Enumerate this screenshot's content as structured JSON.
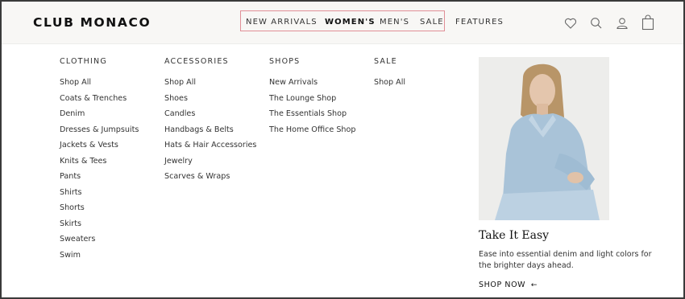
{
  "brand": "CLUB MONACO",
  "nav": {
    "new_arrivals": "NEW ARRIVALS",
    "womens": "WOMEN'S",
    "mens": "MEN'S",
    "sale": "SALE",
    "features": "FEATURES"
  },
  "icons": [
    "heart-icon",
    "search-icon",
    "account-icon",
    "bag-icon"
  ],
  "menu": {
    "clothing": {
      "heading": "CLOTHING",
      "links": [
        "Shop All",
        "Coats & Trenches",
        "Denim",
        "Dresses & Jumpsuits",
        "Jackets & Vests",
        "Knits & Tees",
        "Pants",
        "Shirts",
        "Shorts",
        "Skirts",
        "Sweaters",
        "Swim"
      ]
    },
    "accessories": {
      "heading": "ACCESSORIES",
      "links": [
        "Shop All",
        "Shoes",
        "Candles",
        "Handbags & Belts",
        "Hats & Hair Accessories",
        "Jewelry",
        "Scarves & Wraps"
      ]
    },
    "shops": {
      "heading": "SHOPS",
      "links": [
        "New Arrivals",
        "The Lounge Shop",
        "The Essentials Shop",
        "The Home Office Shop"
      ]
    },
    "sale": {
      "heading": "SALE",
      "links": [
        "Shop All"
      ]
    }
  },
  "promo": {
    "title": "Take It Easy",
    "text": "Ease into essential denim and light colors for the brighter days ahead.",
    "cta": "SHOP NOW",
    "cta_arrow": "←"
  }
}
